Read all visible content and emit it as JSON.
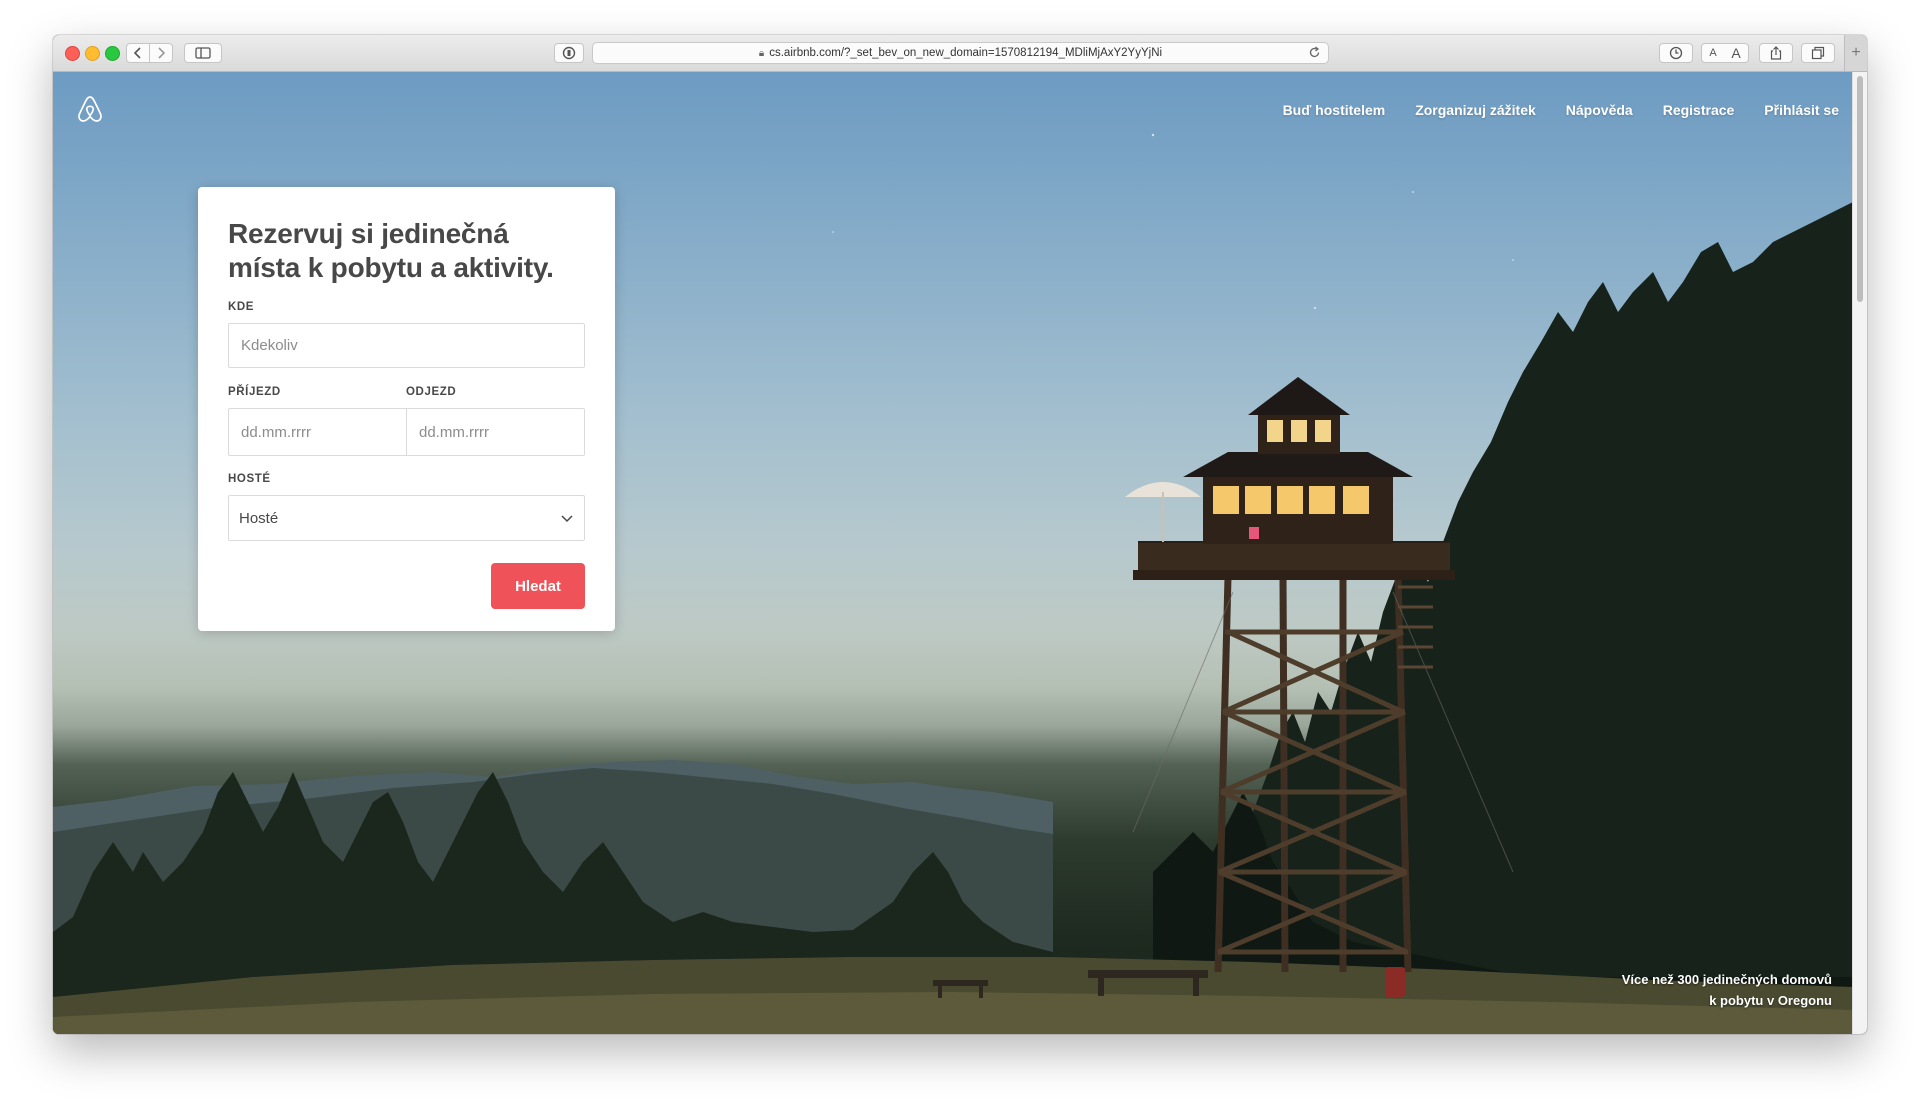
{
  "browser": {
    "url": "cs.airbnb.com/?_set_bev_on_new_domain=1570812194_MDliMjAxY2YyYjNi",
    "icons": {
      "back": "chevron-left-icon",
      "forward": "chevron-right-icon",
      "sidebar": "sidebar-icon",
      "privacy": "privacy-report-icon",
      "reload": "reload-icon",
      "history": "clock-icon",
      "share": "share-icon",
      "tabs": "tabs-overview-icon",
      "new_tab": "plus-icon"
    },
    "text_size": {
      "small": "A",
      "large": "A"
    },
    "new_tab_label": "+"
  },
  "header": {
    "logo_icon": "airbnb-belo-icon",
    "nav": [
      {
        "label": "Buď hostitelem"
      },
      {
        "label": "Zorganizuj zážitek"
      },
      {
        "label": "Nápověda"
      },
      {
        "label": "Registrace"
      },
      {
        "label": "Přihlásit se"
      }
    ]
  },
  "search_card": {
    "title": "Rezervuj si jedinečná místa k pobytu a aktivity.",
    "where": {
      "label": "KDE",
      "placeholder": "Kdekoliv"
    },
    "checkin": {
      "label": "PŘÍJEZD",
      "placeholder": "dd.mm.rrrr"
    },
    "checkout": {
      "label": "ODJEZD",
      "placeholder": "dd.mm.rrrr"
    },
    "guests": {
      "label": "HOSTÉ",
      "selected": "Hosté"
    },
    "search_label": "Hledat"
  },
  "hero": {
    "caption_line1": "Více než 300 jedinečných domovů",
    "caption_line2": "k pobytu v Oregonu"
  },
  "colors": {
    "brand": "#FF5A5F",
    "text_dark": "#484848",
    "sky_top": "#6D9BC2",
    "forest": "#1E2A1F"
  }
}
